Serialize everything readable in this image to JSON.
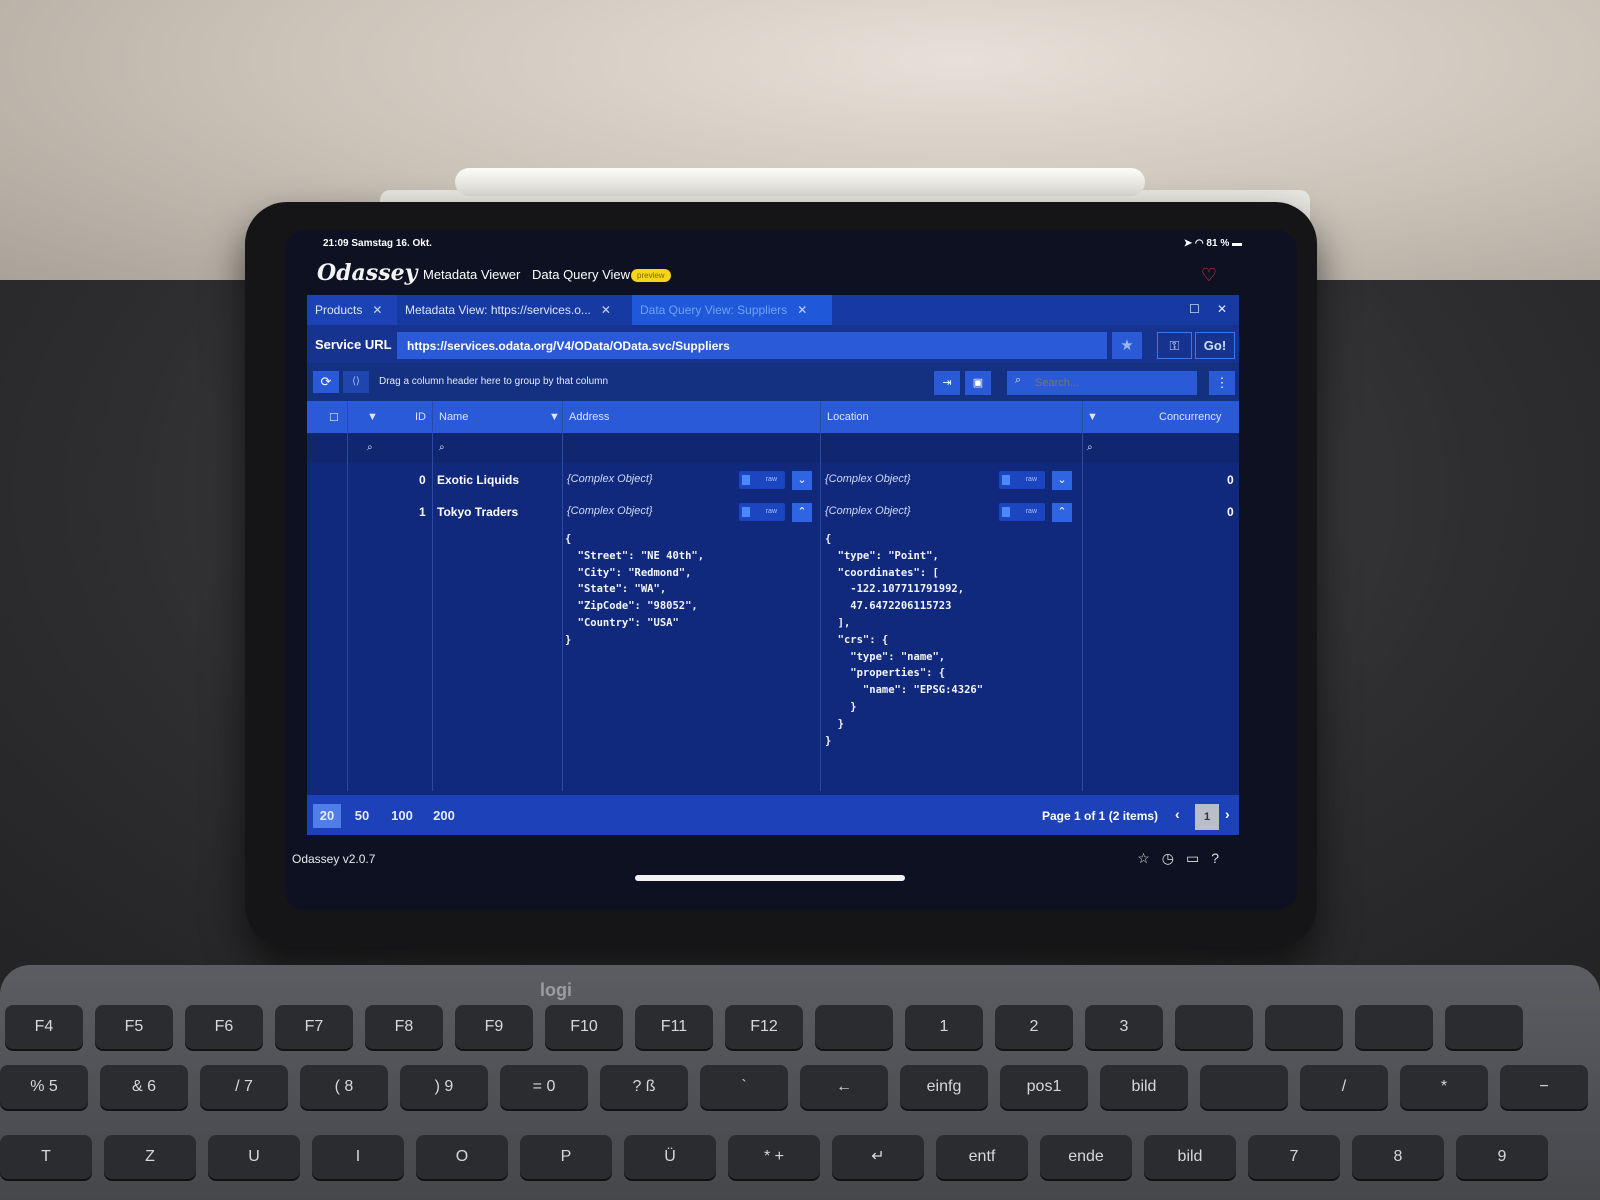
{
  "status": {
    "time": "21:09",
    "date": "Samstag 16. Okt.",
    "battery": "81 %"
  },
  "app": {
    "logo": "Odassey",
    "nav": [
      "Metadata Viewer",
      "Data Query View"
    ],
    "badge": "preview"
  },
  "tabs": [
    {
      "label": "Products"
    },
    {
      "label": "Metadata View: https://services.o..."
    },
    {
      "label": "Data Query View: Suppliers"
    }
  ],
  "service": {
    "label": "Service URL",
    "url": "https://services.odata.org/V4/OData/OData.svc/Suppliers",
    "go": "Go!"
  },
  "toolbar": {
    "group_hint": "Drag a column header here to group by that column",
    "search_placeholder": "Search..."
  },
  "columns": [
    "ID",
    "Name",
    "Address",
    "Location",
    "Concurrency"
  ],
  "rows": [
    {
      "id": "0",
      "name": "Exotic Liquids",
      "address": "{Complex Object}",
      "location": "{Complex Object}",
      "concurrency": "0"
    },
    {
      "id": "1",
      "name": "Tokyo Traders",
      "address": "{Complex Object}",
      "location": "{Complex Object}",
      "concurrency": "0"
    }
  ],
  "raw_label": "raw",
  "expanded": {
    "address_json": "{\n  \"Street\": \"NE 40th\",\n  \"City\": \"Redmond\",\n  \"State\": \"WA\",\n  \"ZipCode\": \"98052\",\n  \"Country\": \"USA\"\n}",
    "location_json": "{\n  \"type\": \"Point\",\n  \"coordinates\": [\n    -122.107711791992,\n    47.6472206115723\n  ],\n  \"crs\": {\n    \"type\": \"name\",\n    \"properties\": {\n      \"name\": \"EPSG:4326\"\n    }\n  }\n}"
  },
  "pager": {
    "sizes": [
      "20",
      "50",
      "100",
      "200"
    ],
    "active_size": "20",
    "info": "Page 1 of 1 (2 items)",
    "page": "1"
  },
  "footer": {
    "version": "Odassey v2.0.7"
  },
  "keyboard": {
    "brand": "logi",
    "row1": [
      "F4",
      "F5",
      "F6",
      "F7",
      "F8",
      "F9",
      "F10",
      "F11",
      "F12",
      "",
      "1",
      "2",
      "3",
      "",
      "",
      "",
      ""
    ],
    "row2": [
      "%\n5",
      "&\n6",
      "/\n7",
      "(\n8",
      ")\n9",
      "=\n0",
      "?\nß",
      "`",
      "←",
      "einfg",
      "pos1",
      "bild",
      "",
      "/",
      "*",
      "−"
    ],
    "row3": [
      "T",
      "Z",
      "U",
      "I",
      "O",
      "P",
      "Ü",
      "*\n+",
      "↵",
      "entf",
      "ende",
      "bild",
      "7",
      "8",
      "9"
    ]
  }
}
